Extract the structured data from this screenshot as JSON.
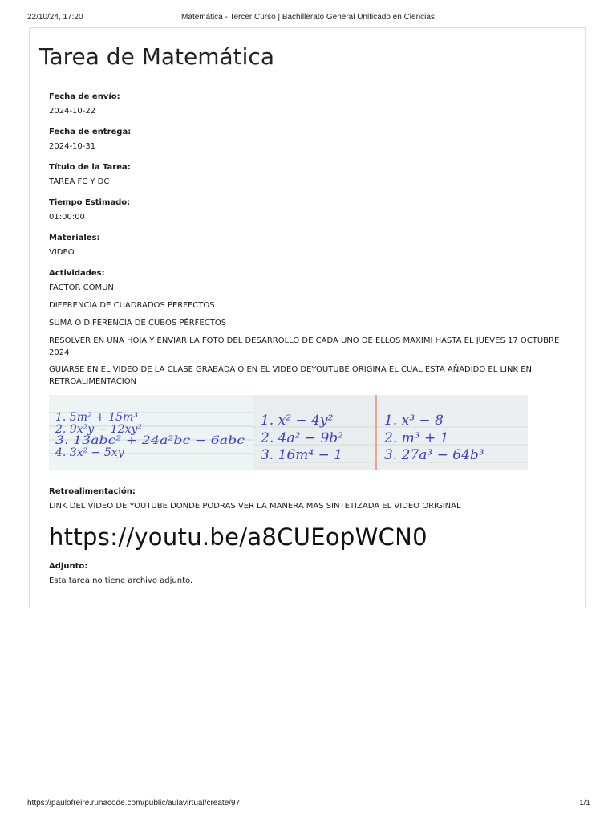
{
  "print_header": {
    "datetime": "22/10/24, 17:20",
    "title": "Matemática - Tercer Curso | Bachillerato General Unificado en Ciencias"
  },
  "print_footer": {
    "url": "https://paulofreire.runacode.com/public/aulavirtual/create/97",
    "page": "1/1"
  },
  "card": {
    "title": "Tarea de Matemática",
    "fields": {
      "fecha_envio": {
        "label": "Fecha de envío:",
        "value": "2024-10-22"
      },
      "fecha_entrega": {
        "label": "Fecha de entrega:",
        "value": "2024-10-31"
      },
      "titulo": {
        "label": "Título de la Tarea:",
        "value": "TAREA FC Y DC"
      },
      "tiempo": {
        "label": "Tiempo Estimado:",
        "value": "01:00:00"
      },
      "materiales": {
        "label": "Materiales:",
        "value": "VIDEO"
      }
    },
    "actividades": {
      "label": "Actividades:",
      "lines": [
        "FACTOR COMUN",
        "DIFERENCIA DE CUADRADOS PERFECTOS",
        "SUMA O DIFERENCIA DE CUBOS PÉRFECTOS",
        "RESOLVER EN UNA HOJA Y ENVIAR LA FOTO DEL DESARROLLO DE CADA UNO DE ELLOS MAXIMI HASTA EL JUEVES 17 OCTUBRE 2024",
        "GUIARSE EN EL VIDEO DE LA CLASE GRABADA O EN EL VIDEO DEYOUTUBE ORIGINA EL CUAL ESTA AÑADIDO EL LINK EN RETROALIMENTACION"
      ]
    },
    "photos": {
      "photo1": [
        "1. 5m² + 15m³",
        "2. 9x²y − 12xy²",
        "3. 13abc² + 24a²bc − 6abc",
        "4. 3x² − 5xy"
      ],
      "photo2": [
        "1. x² − 4y²",
        "2. 4a² − 9b²",
        "3. 16m⁴ − 1"
      ],
      "photo3": [
        "1. x³ − 8",
        "2. m³ + 1",
        "3. 27a³ − 64b³"
      ],
      "ink_color": "#3a3fc4"
    },
    "retro": {
      "label": "Retroalimentación:",
      "text": "LINK DEL VIDEO DE YOUTUBE DONDE PODRAS VER LA MANERA MAS SINTETIZADA EL VIDEO ORIGINAL",
      "link": "https://youtu.be/a8CUEopWCN0"
    },
    "adjunto": {
      "label": "Adjunto:",
      "value": "Esta tarea no tiene archivo adjunto."
    }
  }
}
